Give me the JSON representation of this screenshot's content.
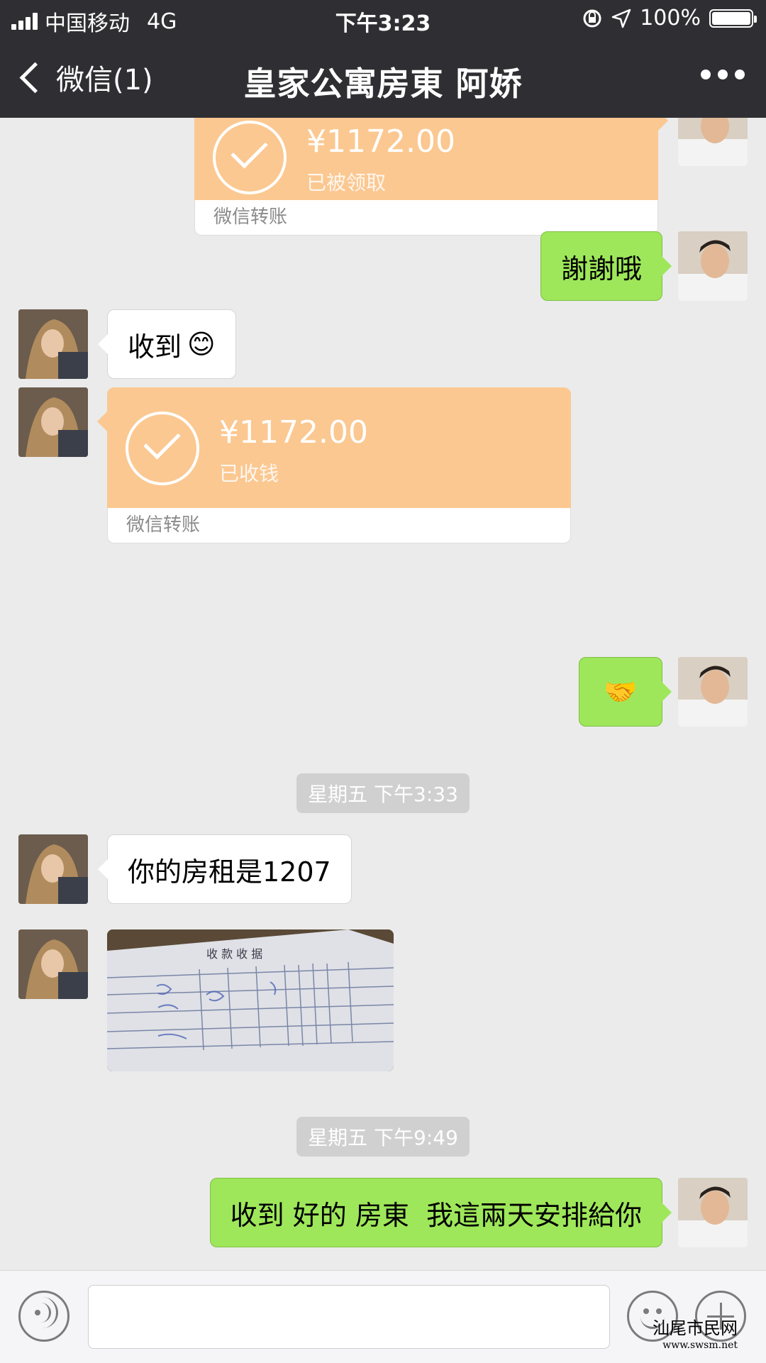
{
  "status_bar": {
    "carrier": "中国移动",
    "network": "4G",
    "time": "下午3:23",
    "battery": "100%",
    "battery_level": 1.0,
    "icons": [
      "signal-bars-icon",
      "rotation-lock-icon",
      "location-arrow-icon",
      "battery-icon"
    ]
  },
  "nav": {
    "back_label": "微信(1)",
    "title": "皇家公寓房東 阿娇",
    "more_icon": "more-dots-icon"
  },
  "messages": [
    {
      "type": "transfer",
      "sender": "me",
      "amount": "¥1172.00",
      "status": "已被领取",
      "footer": "微信转账"
    },
    {
      "type": "text",
      "sender": "me",
      "text": "謝謝哦"
    },
    {
      "type": "text",
      "sender": "her",
      "text": "收到",
      "emoji": "😊"
    },
    {
      "type": "transfer",
      "sender": "her",
      "amount": "¥1172.00",
      "status": "已收钱",
      "footer": "微信转账"
    },
    {
      "type": "emoji",
      "sender": "me",
      "emoji": "🤝"
    },
    {
      "type": "timestamp",
      "text": "星期五 下午3:33"
    },
    {
      "type": "text",
      "sender": "her",
      "text": "你的房租是1207"
    },
    {
      "type": "image",
      "sender": "her",
      "description": "receipt-photo",
      "visible_text": "收 款 收 据"
    },
    {
      "type": "timestamp",
      "text": "星期五 下午9:49"
    },
    {
      "type": "text",
      "sender": "me",
      "text": "收到 好的 房東  我這兩天安排給你"
    }
  ],
  "input_bar": {
    "voice_icon": "voice-icon",
    "emoji_icon": "emoji-face-icon",
    "plus_icon": "plus-icon"
  },
  "watermark": {
    "line1": "汕尾市民网",
    "line2": "www.swsm.net"
  },
  "colors": {
    "nav_bg": "#2f2f33",
    "chat_bg": "#ebebeb",
    "my_bubble": "#9ee75a",
    "transfer_orange": "#fbc891"
  }
}
